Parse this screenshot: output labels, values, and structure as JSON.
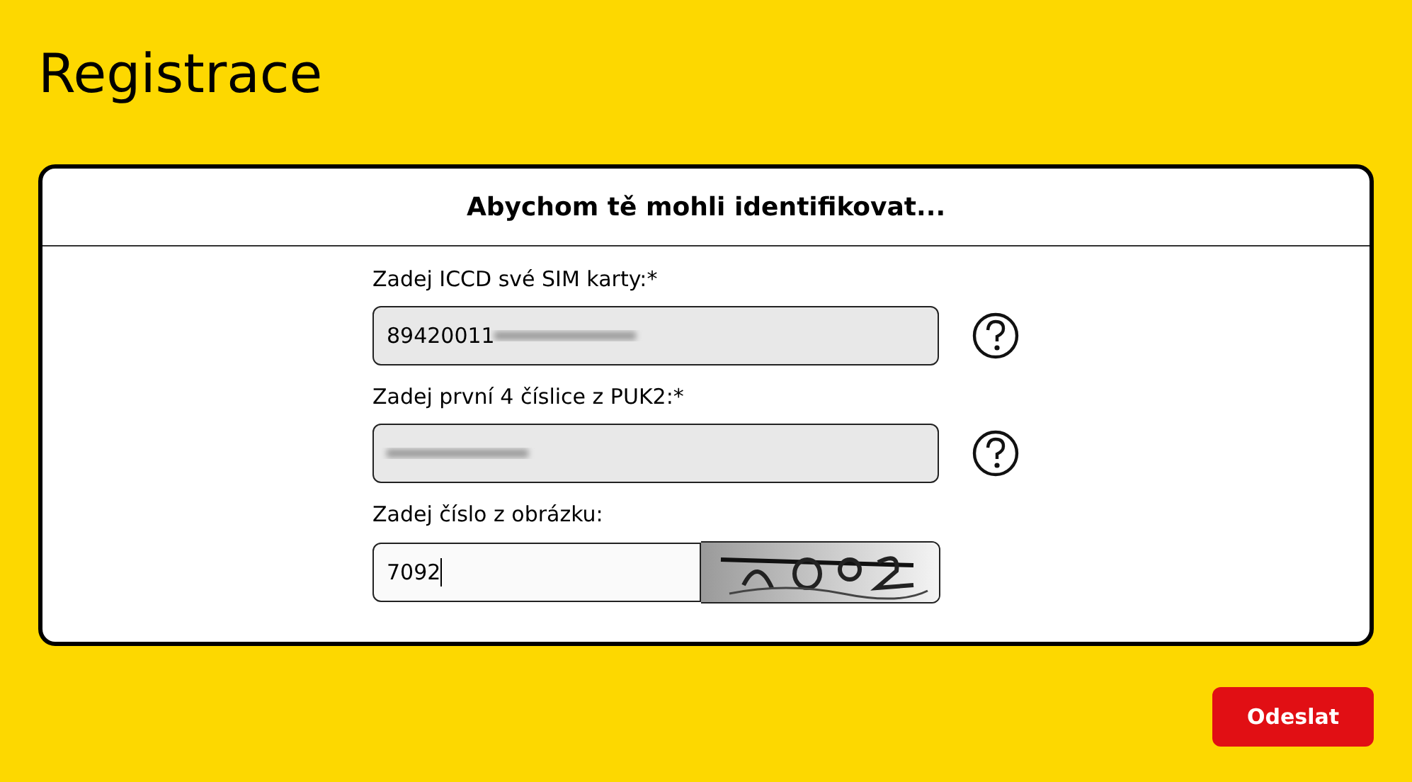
{
  "page_title": "Registrace",
  "card": {
    "heading": "Abychom tě mohli identifikovat...",
    "fields": [
      {
        "label": "Zadej ICCD své SIM karty:*",
        "value": "89420011",
        "redacted": true,
        "readonly": true,
        "focused": false,
        "help": true
      },
      {
        "label": "Zadej první 4 číslice z PUK2:*",
        "redacted": true,
        "readonly": true,
        "focused": false,
        "help": true
      },
      {
        "label": "Zadej číslo z obrázku:",
        "value": "7092",
        "redacted": false,
        "readonly": false,
        "focused": true,
        "help": false
      }
    ]
  },
  "submit_button": "Odeslat"
}
